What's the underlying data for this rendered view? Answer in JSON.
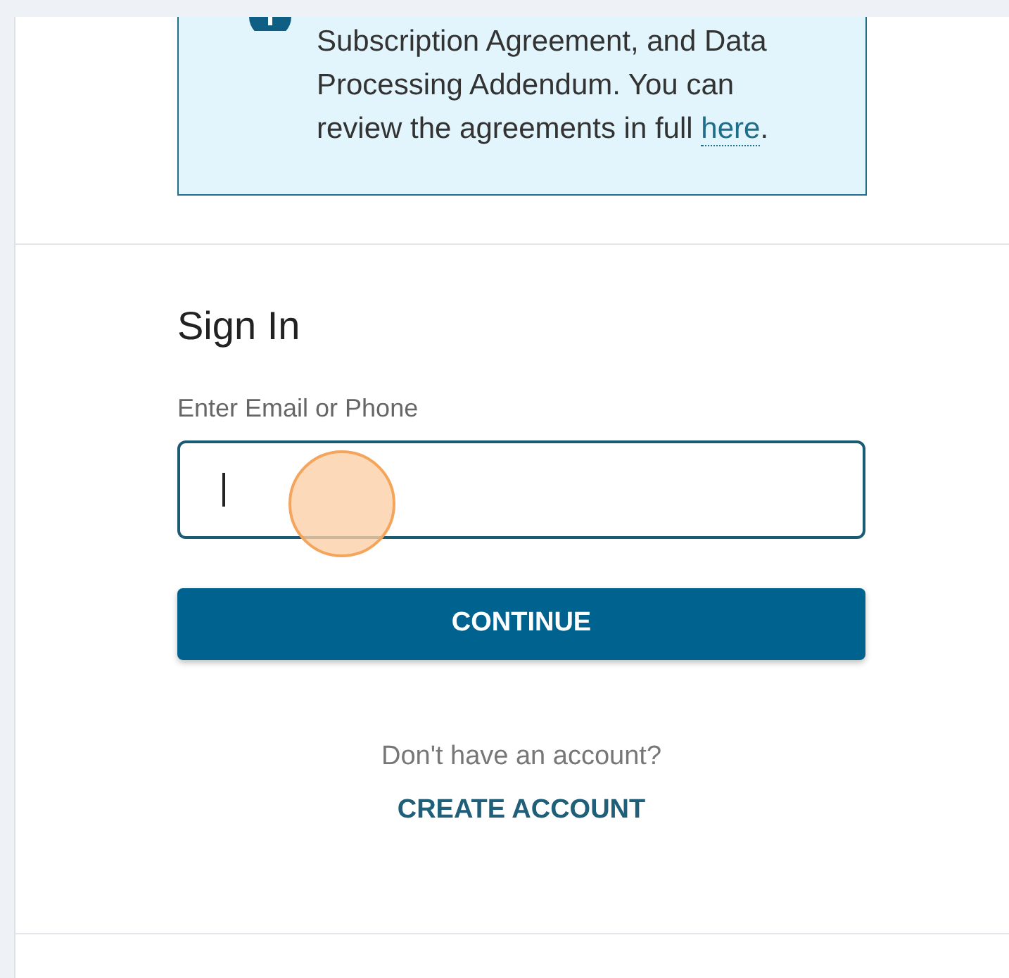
{
  "notice": {
    "text": "Subscription Agreement, and Data Processing Addendum. You can review the agreements in full",
    "link": "here",
    "trailing": "."
  },
  "sign_in": {
    "title": "Sign In",
    "field_label": "Enter Email or Phone",
    "field_focused": true,
    "button": "CONTINUE",
    "prompt": "Don't have an account?",
    "link": "CREATE ACCOUNT"
  }
}
